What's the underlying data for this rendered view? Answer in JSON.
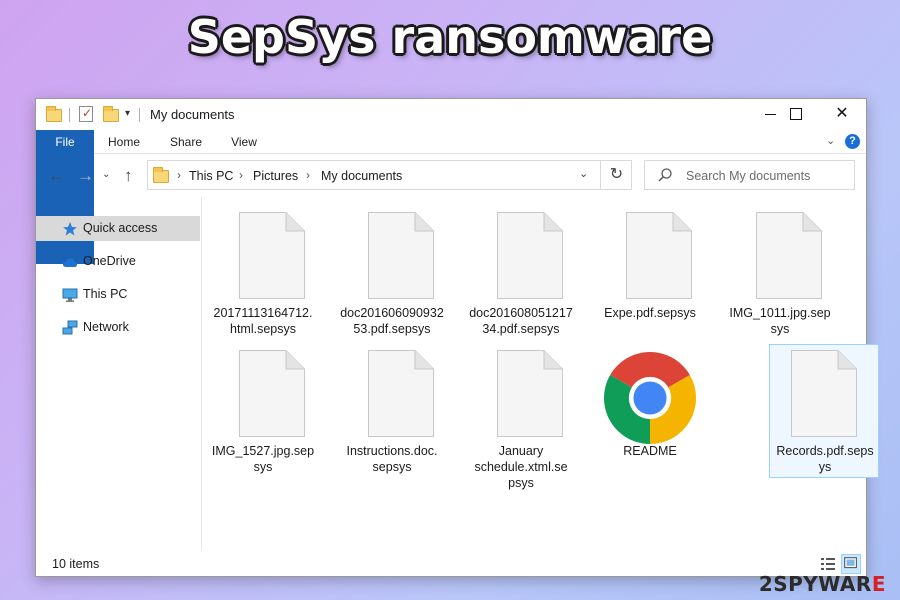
{
  "banner": {
    "title": "SepSys ransomware"
  },
  "window": {
    "title": "My documents",
    "controls": {
      "minimize": "minimize",
      "maximize": "maximize",
      "close": "✕"
    }
  },
  "quick_access_toolbar": {
    "dropdown": "▾"
  },
  "ribbon": {
    "tabs": [
      {
        "label": "File"
      },
      {
        "label": "Home"
      },
      {
        "label": "Share"
      },
      {
        "label": "View"
      }
    ],
    "expand": "⌄",
    "help": "?"
  },
  "nav": {
    "back": "←",
    "forward": "→",
    "recent": "⌄",
    "up": "↑"
  },
  "address": {
    "breadcrumbs": [
      "This PC",
      "Pictures",
      "My documents"
    ],
    "separator": "›",
    "dropdown": "⌄",
    "refresh": "↻"
  },
  "search": {
    "placeholder": "Search My documents"
  },
  "navigation_pane": {
    "items": [
      {
        "label": "Quick access",
        "icon": "star-icon",
        "selected": true
      },
      {
        "label": "OneDrive",
        "icon": "cloud-icon",
        "selected": false
      },
      {
        "label": "This PC",
        "icon": "computer-icon",
        "selected": false
      },
      {
        "label": "Network",
        "icon": "network-icon",
        "selected": false
      }
    ]
  },
  "files": [
    {
      "name": "20171113164712.\nhtml.sepsys",
      "icon": "document-icon"
    },
    {
      "name": "doc201606090932\n53.pdf.sepsys",
      "icon": "document-icon"
    },
    {
      "name": "doc201608051217\n34.pdf.sepsys",
      "icon": "document-icon"
    },
    {
      "name": "Expe.pdf.sepsys",
      "icon": "document-icon"
    },
    {
      "name": "IMG_1011.jpg.sep\nsys",
      "icon": "document-icon"
    },
    {
      "name": "IMG_1527.jpg.sep\nsys",
      "icon": "document-icon"
    },
    {
      "name": "Instructions.doc.\nsepsys",
      "icon": "document-icon"
    },
    {
      "name": "January\nschedule.xtml.se\npsys",
      "icon": "document-icon"
    },
    {
      "name": "README",
      "icon": "chrome-icon"
    },
    {
      "name": "Records.pdf.seps\nys",
      "icon": "document-icon",
      "selected": true
    }
  ],
  "status_bar": {
    "item_count": "10 items"
  },
  "watermark": {
    "prefix": "2SPYWAR",
    "suffix": "E"
  },
  "colors": {
    "file_tab": "#1a62b6",
    "selection": "#cce8ff",
    "selection_border": "#99d1ff",
    "folder": "#f8d778",
    "watermark_accent": "#d61f26"
  }
}
